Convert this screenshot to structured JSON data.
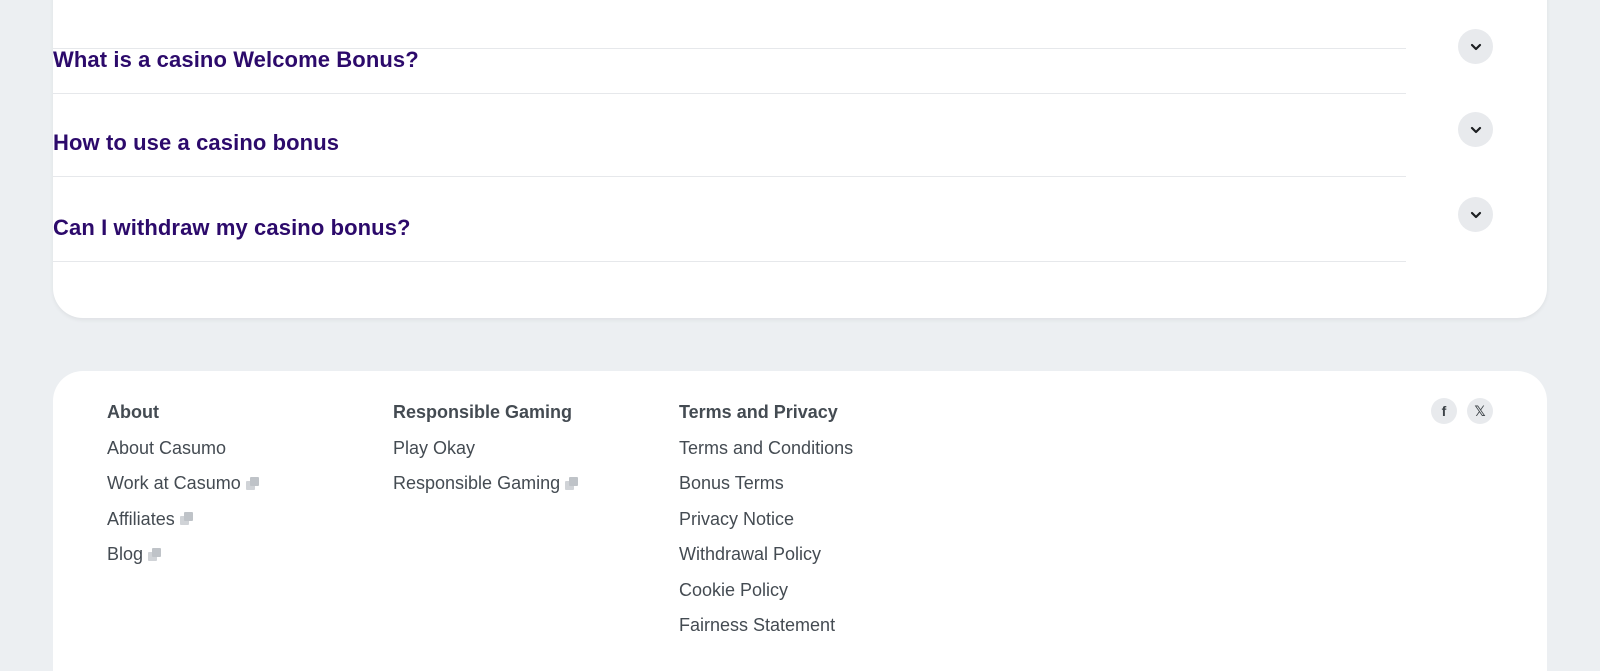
{
  "faq": {
    "items": [
      {
        "question": "What is a casino Welcome Bonus?"
      },
      {
        "question": "How to use a casino bonus"
      },
      {
        "question": "Can I withdraw my casino bonus?"
      }
    ]
  },
  "footer": {
    "about": {
      "heading": "About",
      "links": [
        "About Casumo",
        "Work at Casumo",
        "Affiliates",
        "Blog"
      ]
    },
    "responsible": {
      "heading": "Responsible Gaming",
      "links": [
        "Play Okay",
        "Responsible Gaming"
      ]
    },
    "terms": {
      "heading": "Terms and Privacy",
      "links": [
        "Terms and Conditions",
        "Bonus Terms",
        "Privacy Notice",
        "Withdrawal Policy",
        "Cookie Policy",
        "Fairness Statement"
      ]
    },
    "social": {
      "facebook": "f",
      "x": "𝕏"
    }
  },
  "colors": {
    "question": "#2c0a6b",
    "link": "#444b52",
    "background": "#eceff2"
  }
}
